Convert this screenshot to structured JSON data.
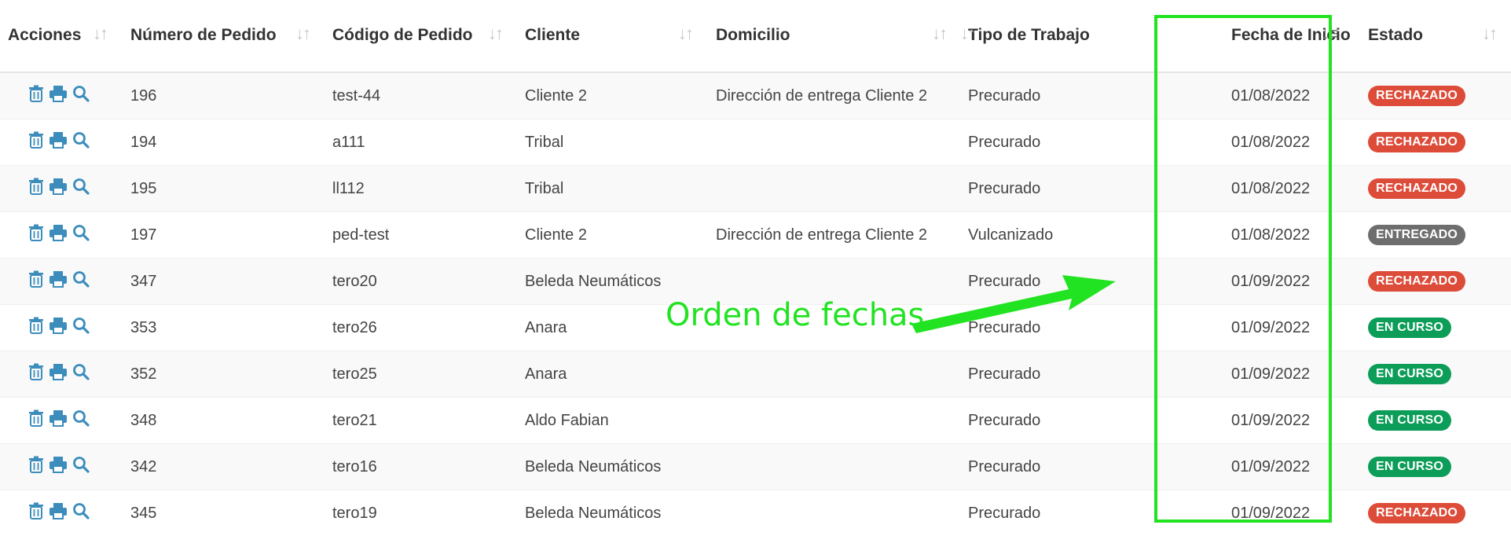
{
  "table": {
    "columns": [
      {
        "key": "acciones",
        "label": "Acciones",
        "sort_icon": "sort-icon",
        "sorted": false
      },
      {
        "key": "numero",
        "label": "Número de Pedido",
        "sort_icon": "sort-icon",
        "sorted": false
      },
      {
        "key": "codigo",
        "label": "Código de Pedido",
        "sort_icon": "sort-icon",
        "sorted": false
      },
      {
        "key": "cliente",
        "label": "Cliente",
        "sort_icon": "sort-icon",
        "sorted": false
      },
      {
        "key": "domicilio",
        "label": "Domicilio",
        "sort_icon": "sort-icon",
        "sorted": false
      },
      {
        "key": "tipo",
        "label": "Tipo de Trabajo",
        "sort_icon": "sort-icon",
        "sorted": false
      },
      {
        "key": "fecha",
        "label": "Fecha de Inicio",
        "sort_icon": "sort-ascending-icon",
        "sorted": true
      },
      {
        "key": "estado",
        "label": "Estado",
        "sort_icon": "sort-icon",
        "sorted": false
      }
    ],
    "action_icons": [
      "trash-icon",
      "print-icon",
      "search-icon"
    ],
    "rows": [
      {
        "numero": "196",
        "codigo": "test-44",
        "cliente": "Cliente 2",
        "domicilio": "Dirección de entrega Cliente 2",
        "tipo": "Precurado",
        "fecha": "01/08/2022",
        "estado": "RECHAZADO"
      },
      {
        "numero": "194",
        "codigo": "a111",
        "cliente": "Tribal",
        "domicilio": "",
        "tipo": "Precurado",
        "fecha": "01/08/2022",
        "estado": "RECHAZADO"
      },
      {
        "numero": "195",
        "codigo": "ll112",
        "cliente": "Tribal",
        "domicilio": "",
        "tipo": "Precurado",
        "fecha": "01/08/2022",
        "estado": "RECHAZADO"
      },
      {
        "numero": "197",
        "codigo": "ped-test",
        "cliente": "Cliente 2",
        "domicilio": "Dirección de entrega Cliente 2",
        "tipo": "Vulcanizado",
        "fecha": "01/08/2022",
        "estado": "ENTREGADO"
      },
      {
        "numero": "347",
        "codigo": "tero20",
        "cliente": "Beleda Neumáticos",
        "domicilio": "",
        "tipo": "Precurado",
        "fecha": "01/09/2022",
        "estado": "RECHAZADO"
      },
      {
        "numero": "353",
        "codigo": "tero26",
        "cliente": "Anara",
        "domicilio": "",
        "tipo": "Precurado",
        "fecha": "01/09/2022",
        "estado": "EN CURSO"
      },
      {
        "numero": "352",
        "codigo": "tero25",
        "cliente": "Anara",
        "domicilio": "",
        "tipo": "Precurado",
        "fecha": "01/09/2022",
        "estado": "EN CURSO"
      },
      {
        "numero": "348",
        "codigo": "tero21",
        "cliente": "Aldo Fabian",
        "domicilio": "",
        "tipo": "Precurado",
        "fecha": "01/09/2022",
        "estado": "EN CURSO"
      },
      {
        "numero": "342",
        "codigo": "tero16",
        "cliente": "Beleda Neumáticos",
        "domicilio": "",
        "tipo": "Precurado",
        "fecha": "01/09/2022",
        "estado": "EN CURSO"
      },
      {
        "numero": "345",
        "codigo": "tero19",
        "cliente": "Beleda Neumáticos",
        "domicilio": "",
        "tipo": "Precurado",
        "fecha": "01/09/2022",
        "estado": "RECHAZADO"
      }
    ]
  },
  "status_colors": {
    "RECHAZADO": "#dd4b39",
    "ENTREGADO": "#6e6e6e",
    "EN CURSO": "#0c9d58"
  },
  "colors": {
    "action_icon": "#3c8dbc",
    "annotation": "#22e322"
  },
  "annotation": {
    "text": "Orden de fechas"
  }
}
